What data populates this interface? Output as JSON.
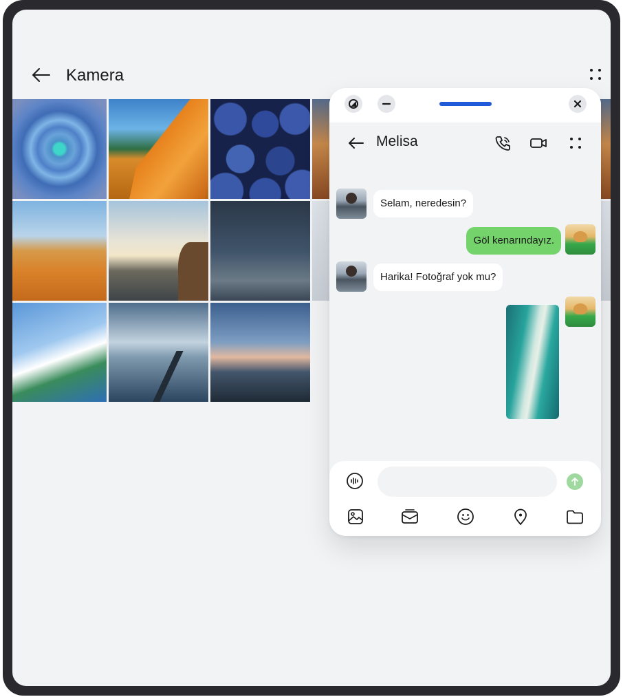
{
  "gallery": {
    "title": "Kamera",
    "back_icon": "arrow-left-icon",
    "more_icon": "more-dots-icon",
    "photos": [
      "succulent",
      "tent",
      "blueberries",
      "sunset",
      "desert-camels",
      "cliff-jump",
      "fishing-net",
      "partial",
      "snowboarder",
      "pier",
      "dusk-coast"
    ]
  },
  "chat": {
    "window_controls": {
      "split_icon": "split-screen-icon",
      "minimize_icon": "minimize-icon",
      "close_icon": "close-icon"
    },
    "contact_name": "Melisa",
    "header_icons": [
      "arrow-left-icon",
      "phone-icon",
      "video-call-icon",
      "more-dots-icon"
    ],
    "messages": [
      {
        "from": "Melisa",
        "type": "text",
        "text": "Selam, neredesin?"
      },
      {
        "from": "me",
        "type": "text",
        "text": "Göl kenarındayız."
      },
      {
        "from": "Melisa",
        "type": "text",
        "text": "Harika! Fotoğraf yok mu?"
      },
      {
        "from": "me",
        "type": "image",
        "text": ""
      }
    ],
    "composer": {
      "placeholder": "",
      "value": "",
      "tools": [
        "image-icon",
        "card-icon",
        "emoji-icon",
        "location-icon",
        "folder-icon"
      ]
    }
  },
  "colors": {
    "accent": "#1f5bd8",
    "outgoing_bubble": "#74d36b",
    "incoming_bubble": "#ffffff",
    "background": "#f1f3f5"
  }
}
